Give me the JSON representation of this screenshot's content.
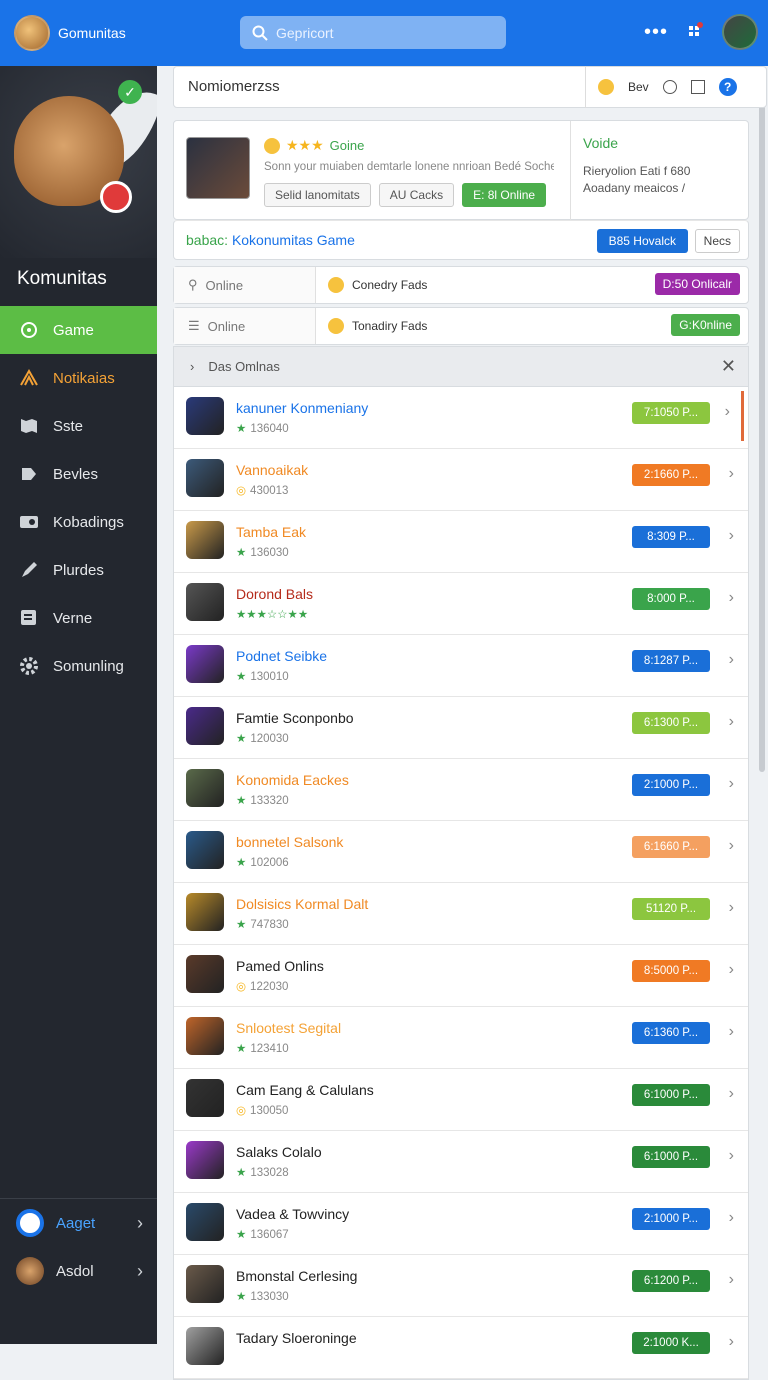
{
  "topbar": {
    "brand": "Gomunitas",
    "search_placeholder": "Gepricort",
    "menu_glyph": "•••"
  },
  "sidebar": {
    "title": "Komunitas",
    "items": [
      {
        "label": "Game",
        "icon": "gamepad-icon",
        "active": true
      },
      {
        "label": "Notikaias",
        "icon": "notifications-icon"
      },
      {
        "label": "Sste",
        "icon": "map-icon"
      },
      {
        "label": "Bevles",
        "icon": "puzzle-icon"
      },
      {
        "label": "Kobadings",
        "icon": "ticket-icon"
      },
      {
        "label": "Plurdes",
        "icon": "pen-icon"
      },
      {
        "label": "Verne",
        "icon": "list-icon"
      },
      {
        "label": "Somunling",
        "icon": "gear-icon"
      }
    ],
    "bottom": [
      {
        "label": "Aaget",
        "icon": "circle-icon"
      },
      {
        "label": "Asdol",
        "icon": "avatar-icon"
      }
    ]
  },
  "header": {
    "title": "Nomiomerzss",
    "bev": "Bev"
  },
  "featured": {
    "status": "Goine",
    "stars": "★★★",
    "desc": "Sonn your muiaben demtarle lonene nnrioan Bedé Soche...",
    "buttons": [
      "Selid lanomitats",
      "AU Cacks",
      "E: 8l Online"
    ],
    "side_title": "Voide",
    "side_desc": "Rieryolion Eati f 680 Aoadany meaicos /",
    "game_label_prefix": "babac:",
    "game_label": "Kokonumitas Game",
    "blue_button": "B85 Hovalck",
    "ghost_button": "Necs"
  },
  "filters": [
    {
      "left": "Online",
      "mid": "Conedry Fads",
      "tag": "D:50 Onlicalr",
      "tag_color": "#9b2aa8"
    },
    {
      "left": "Online",
      "mid": "Tonadiry Fads",
      "tag": "G:K0nline",
      "tag_color": "#4cae4c"
    }
  ],
  "list_header": "Das Omlnas",
  "games": [
    {
      "name": "kanuner Konmeniany",
      "sub": "136040",
      "price": "7:1050 P...",
      "name_color": "#1a73e8",
      "price_color": "#8cc63f",
      "thumb": "#2a3a7a",
      "sub_icon": "★"
    },
    {
      "name": "Vannoaikak",
      "sub": "430013",
      "price": "2:1660 P...",
      "name_color": "#f08a24",
      "price_color": "#f07a24",
      "thumb": "#3c5a7a",
      "sub_icon": "◎"
    },
    {
      "name": "Tamba Eak",
      "sub": "136030",
      "price": "8:309 P...",
      "name_color": "#f08a24",
      "price_color": "#1a6fd8",
      "thumb": "#c99a4a",
      "sub_icon": "★"
    },
    {
      "name": "Dorond Bals",
      "sub": "",
      "price": "8:000 P...",
      "name_color": "#b52a1a",
      "price_color": "#3aa44b",
      "thumb": "#555555",
      "sub_icon": "★★★☆☆★★"
    },
    {
      "name": "Podnet Seibke",
      "sub": "130010",
      "price": "8:1287 P...",
      "name_color": "#1a73e8",
      "price_color": "#1a6fd8",
      "thumb": "#7a3ac9",
      "sub_icon": "★"
    },
    {
      "name": "Famtie Sconponbo",
      "sub": "120030",
      "price": "6:1300 P...",
      "name_color": "#222222",
      "price_color": "#8cc63f",
      "thumb": "#4a2a8a",
      "sub_icon": "★"
    },
    {
      "name": "Konomida Eackes",
      "sub": "133320",
      "price": "2:1000 P...",
      "name_color": "#f08a24",
      "price_color": "#1a6fd8",
      "thumb": "#5a6a4a",
      "sub_icon": "★"
    },
    {
      "name": "bonnetel Salsonk",
      "sub": "102006",
      "price": "6:1660 P...",
      "name_color": "#f08a24",
      "price_color": "#f4a060",
      "thumb": "#2a5a8a",
      "sub_icon": "★"
    },
    {
      "name": "Dolsisics Kormal Dalt",
      "sub": "747830",
      "price": "51120 P...",
      "name_color": "#f08a24",
      "price_color": "#8cc63f",
      "thumb": "#b88a2a",
      "sub_icon": "★"
    },
    {
      "name": "Pamed Onlins",
      "sub": "122030",
      "price": "8:5000 P...",
      "name_color": "#222222",
      "price_color": "#f07a24",
      "thumb": "#5a3a2a",
      "sub_icon": "◎"
    },
    {
      "name": "Snlootest Segital",
      "sub": "123410",
      "price": "6:1360 P...",
      "name_color": "#f4a236",
      "price_color": "#1a6fd8",
      "thumb": "#c0652a",
      "sub_icon": "★"
    },
    {
      "name": "Cam Eang & Calulans",
      "sub": "130050",
      "price": "6:1000 P...",
      "name_color": "#222222",
      "price_color": "#2a8a3a",
      "thumb": "#333333",
      "sub_icon": "◎"
    },
    {
      "name": "Salaks Colalo",
      "sub": "133028",
      "price": "6:1000 P...",
      "name_color": "#222222",
      "price_color": "#2a8a3a",
      "thumb": "#9a3ac9",
      "sub_icon": "★"
    },
    {
      "name": "Vadea & Towvincy",
      "sub": "136067",
      "price": "2:1000 P...",
      "name_color": "#222222",
      "price_color": "#1a6fd8",
      "thumb": "#2a4a6a",
      "sub_icon": "★"
    },
    {
      "name": "Bmonstal Cerlesing",
      "sub": "133030",
      "price": "6:1200 P...",
      "name_color": "#222222",
      "price_color": "#2a8a3a",
      "thumb": "#6a5a4a",
      "sub_icon": "★"
    },
    {
      "name": "Tadary Sloeroninge",
      "sub": "",
      "price": "2:1000 K...",
      "name_color": "#222222",
      "price_color": "#2a8a3a",
      "thumb": "#a0a0a0",
      "sub_icon": ""
    }
  ]
}
